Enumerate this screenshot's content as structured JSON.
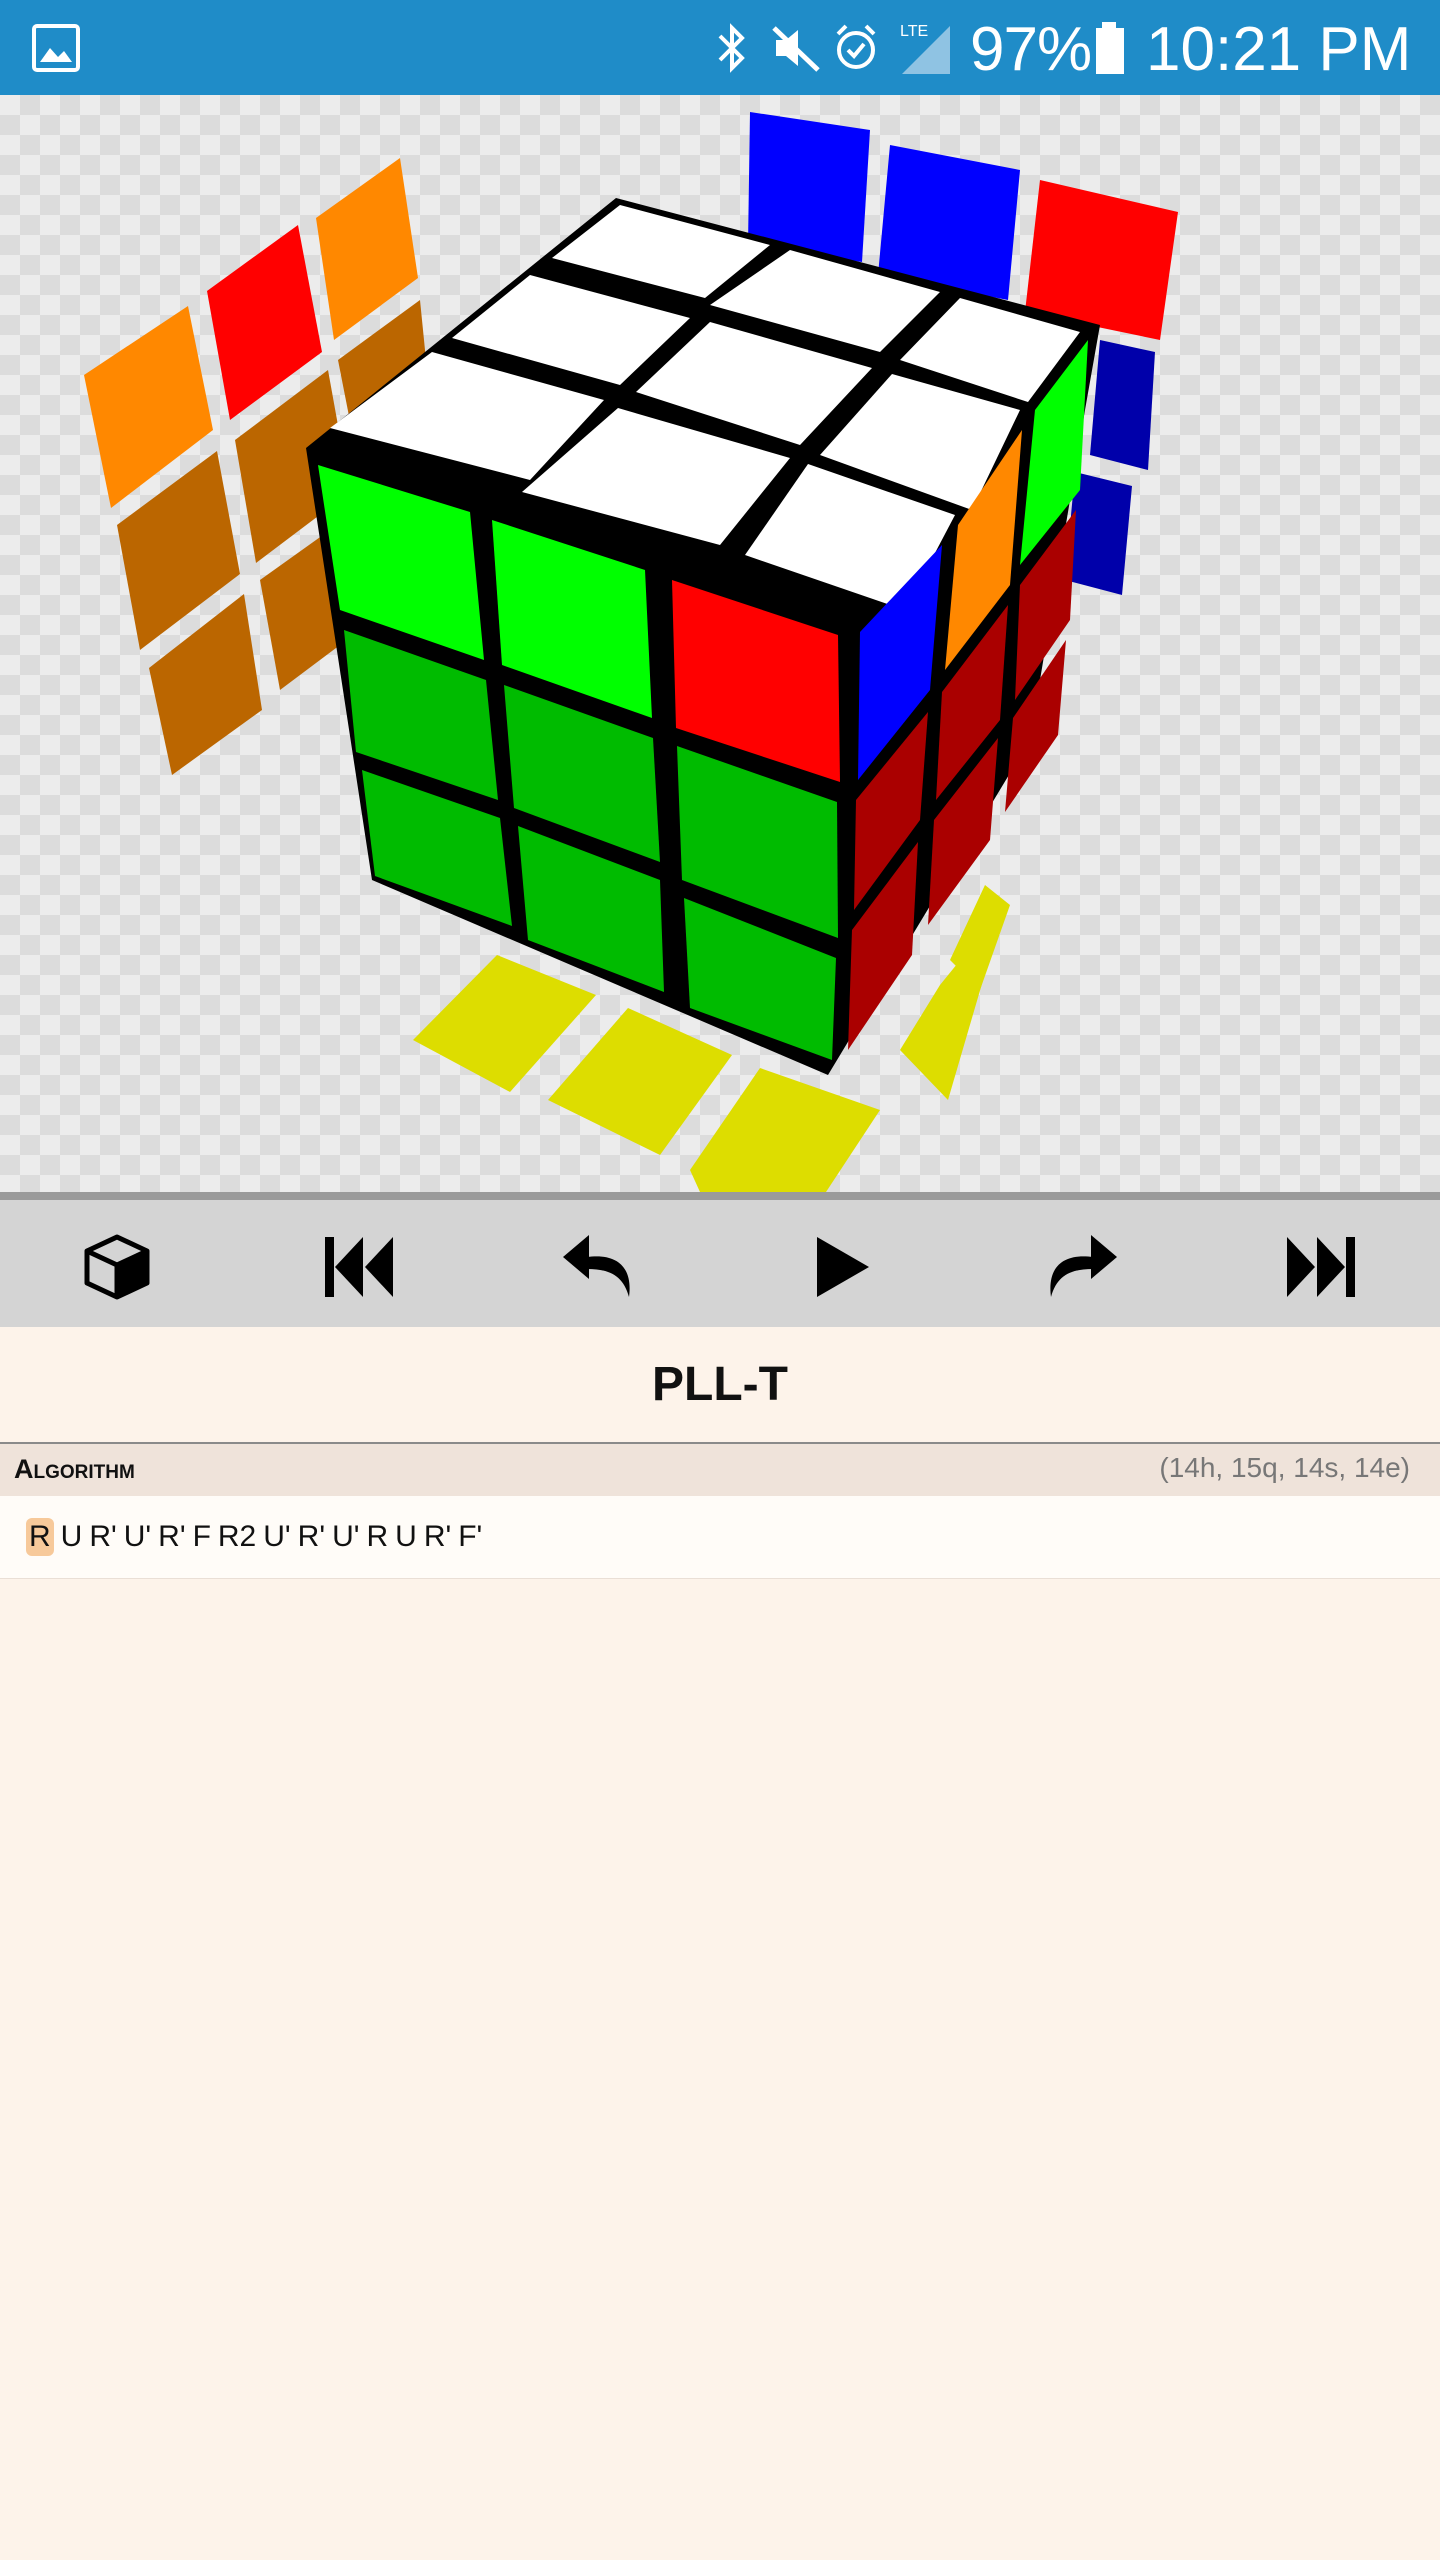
{
  "status_bar": {
    "battery_percent": "97%",
    "time": "10:21 PM",
    "network": "LTE",
    "icons": [
      "gallery-icon",
      "bluetooth-icon",
      "mute-icon",
      "alarm-icon",
      "signal-icon",
      "battery-icon"
    ]
  },
  "toolbar": {
    "buttons": [
      {
        "name": "cube-view-button",
        "icon": "cube-icon"
      },
      {
        "name": "skip-to-start-button",
        "icon": "skip-back-icon"
      },
      {
        "name": "undo-button",
        "icon": "undo-icon"
      },
      {
        "name": "play-button",
        "icon": "play-icon"
      },
      {
        "name": "redo-button",
        "icon": "redo-icon"
      },
      {
        "name": "skip-to-end-button",
        "icon": "skip-forward-icon"
      }
    ]
  },
  "title": "PLL-T",
  "algorithm": {
    "label": "Algorithm",
    "stats": "(14h, 15q, 14s, 14e)",
    "moves": [
      "R",
      "U",
      "R'",
      "U'",
      "R'",
      "F",
      "R2",
      "U'",
      "R'",
      "U'",
      "R",
      "U",
      "R'",
      "F'"
    ],
    "current_index": 0
  },
  "colors": {
    "status_bar": "#1f8cc8",
    "white": "#ffffff",
    "green": "#00ff00",
    "dark_green": "#00bb00",
    "red": "#ff0000",
    "dark_red": "#aa0000",
    "blue": "#0000ff",
    "dark_blue": "#0000aa",
    "orange": "#ff8800",
    "dark_orange": "#bb6600",
    "yellow": "#dddd00",
    "highlight": "#f7c99a"
  }
}
